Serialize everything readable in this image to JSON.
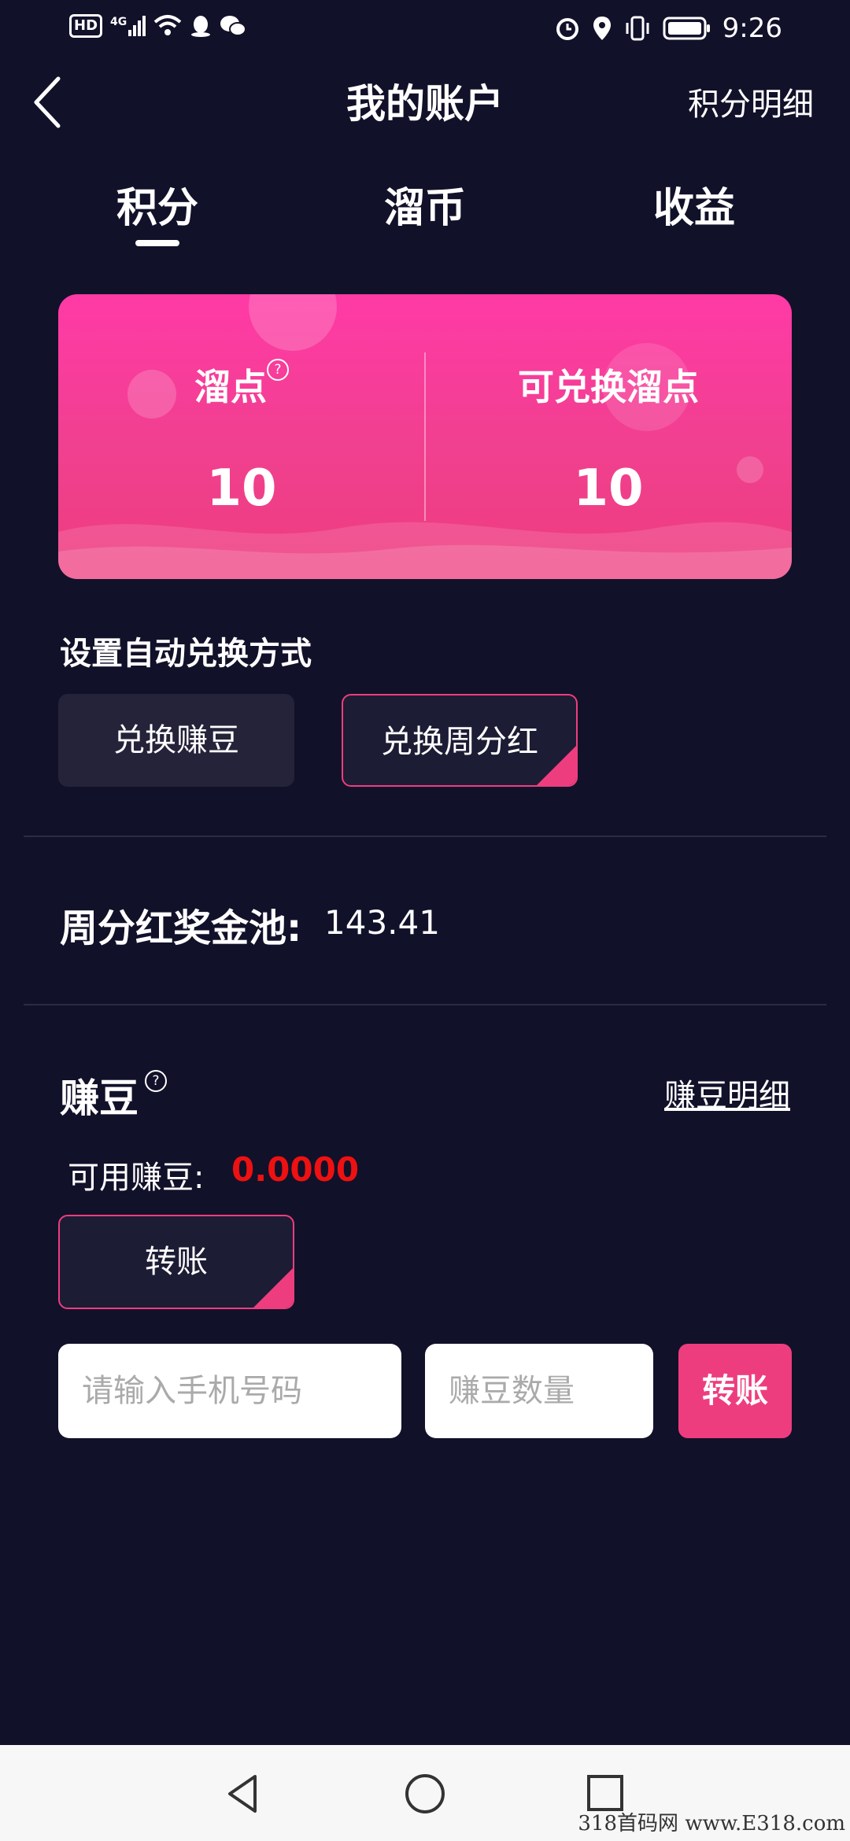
{
  "status_bar": {
    "hd_label": "HD",
    "signal_label": "4G",
    "time": "9:26"
  },
  "header": {
    "title": "我的账户",
    "right_link": "积分明细"
  },
  "tabs": [
    {
      "label": "积分",
      "active": true
    },
    {
      "label": "溜币",
      "active": false
    },
    {
      "label": "收益",
      "active": false
    }
  ],
  "points_card": {
    "left_label": "溜点",
    "left_value": "10",
    "right_label": "可兑换溜点",
    "right_value": "10",
    "help_glyph": "?"
  },
  "auto_exchange": {
    "label": "设置自动兑换方式",
    "options": [
      {
        "label": "兑换赚豆",
        "selected": false
      },
      {
        "label": "兑换周分红",
        "selected": true
      }
    ]
  },
  "bonus_pool": {
    "label": "周分红奖金池:",
    "value": "143.41"
  },
  "beans": {
    "title": "赚豆",
    "help_glyph": "?",
    "detail_link": "赚豆明细",
    "available_label": "可用赚豆:",
    "available_value": "0.0000",
    "transfer_tab_label": "转账",
    "phone_placeholder": "请输入手机号码",
    "amount_placeholder": "赚豆数量",
    "transfer_button": "转账"
  },
  "watermark": "318首码网  www.E318.com",
  "colors": {
    "background": "#12112a",
    "accent": "#ee3d7e",
    "card_gradient_top": "#ff3aa6",
    "available_value": "#ee1111"
  }
}
